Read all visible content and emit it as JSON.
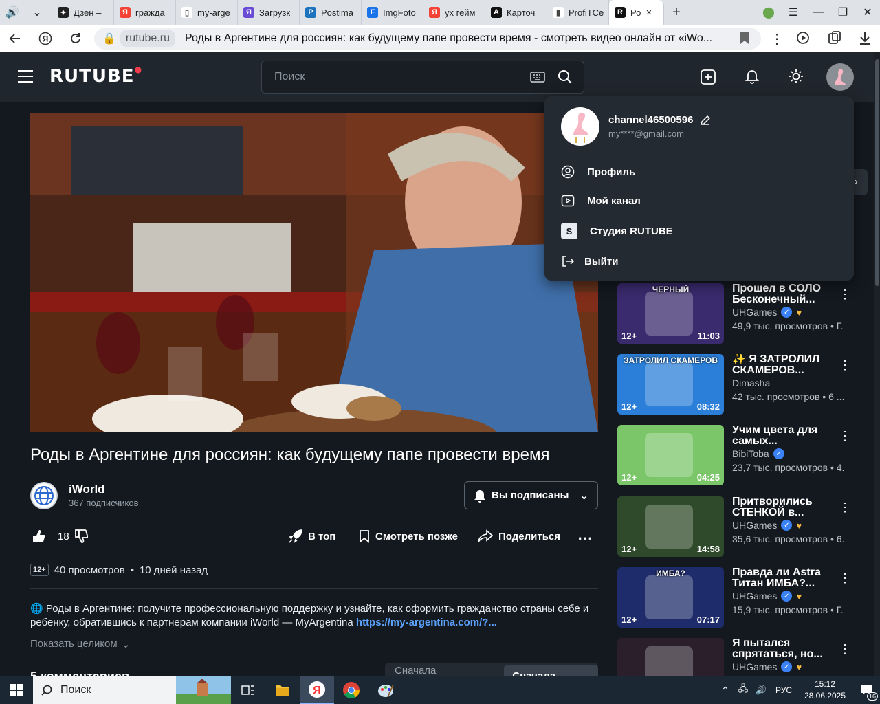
{
  "browser": {
    "tabs": [
      {
        "label": "Дзен –",
        "fav_color": "#222222",
        "fav_glyph": "✦"
      },
      {
        "label": "гражда",
        "fav_color": "#f44336",
        "fav_glyph": "Я"
      },
      {
        "label": "my-arge",
        "fav_color": "#ffffff",
        "fav_glyph": "▯"
      },
      {
        "label": "Загрузк",
        "fav_color": "#6a4bd6",
        "fav_glyph": "Я"
      },
      {
        "label": "Postima",
        "fav_color": "#1e73be",
        "fav_glyph": "P"
      },
      {
        "label": "ImgFoto",
        "fav_color": "#1a73e8",
        "fav_glyph": "F"
      },
      {
        "label": "ух гейм",
        "fav_color": "#f44336",
        "fav_glyph": "Я"
      },
      {
        "label": "Карточ",
        "fav_color": "#111111",
        "fav_glyph": "A"
      },
      {
        "label": "ProfiTCe",
        "fav_color": "#ffffff",
        "fav_glyph": "▮"
      },
      {
        "label": "Ро",
        "fav_color": "#111111",
        "fav_glyph": "R"
      }
    ],
    "url_host": "rutube.ru",
    "url_title": "Роды в Аргентине для россиян: как будущему папе провести время - смотреть видео онлайн от «iWo..."
  },
  "header": {
    "logo": "RUTUBE",
    "search_placeholder": "Поиск"
  },
  "video": {
    "title": "Роды в Аргентине для россиян: как будущему папе провести время",
    "channel_name": "iWorld",
    "subscribers": "367 подписчиков",
    "subscribe_label": "Вы подписаны",
    "likes": "18",
    "top_label": "В топ",
    "watch_later_label": "Смотреть позже",
    "share_label": "Поделиться",
    "age": "12+",
    "views": "40 просмотров",
    "dot": "•",
    "ago": "10 дней назад",
    "description_prefix": "🌐 Роды в Аргентине: получите профессиональную поддержку и узнайте, как оформить гражданство страны себе и ребенку, обратившись к партнерам компании iWorld — MyArgentina ",
    "description_link": "https://my-argentina.com/?...",
    "show_more": "Показать целиком",
    "comments_heading": "5 комментариев",
    "sort_popular": "Сначала популярные",
    "sort_new": "Сначала новые"
  },
  "account_menu": {
    "username": "channel46500596",
    "email": "my****@gmail.com",
    "items": [
      {
        "label": "Профиль",
        "icon": "profile-icon"
      },
      {
        "label": "Мой канал",
        "icon": "play-square-icon"
      },
      {
        "label": "Студия RUTUBE",
        "icon": "studio-icon"
      },
      {
        "label": "Выйти",
        "icon": "logout-icon"
      }
    ]
  },
  "recommendations": [
    {
      "title": "Прошел в СОЛО Бесконечный...",
      "channel": "UHGames",
      "verified": true,
      "heart": true,
      "views": "49,9 тыс. просмотров",
      "ago": "Г.",
      "age": "12+",
      "duration": "11:03",
      "thumb_color": "#3a2a6e",
      "thumb_text": "ЧЕРНЫЙ"
    },
    {
      "title": "✨ Я ЗАТРОЛИЛ СКАМЕРОВ...",
      "channel": "Dimasha",
      "verified": false,
      "heart": false,
      "views": "42 тыс. просмотров",
      "ago": "6 ...",
      "age": "12+",
      "duration": "08:32",
      "thumb_color": "#2b7fd9",
      "thumb_text": "ЗАТРОЛИЛ СКАМЕРОВ"
    },
    {
      "title": "Учим цвета для самых...",
      "channel": "BibiToba",
      "verified": true,
      "heart": false,
      "views": "23,7 тыс. просмотров",
      "ago": "4.",
      "age": "12+",
      "duration": "04:25",
      "thumb_color": "#7cc66a",
      "thumb_text": ""
    },
    {
      "title": "Притворились СТЕНКОЙ в...",
      "channel": "UHGames",
      "verified": true,
      "heart": true,
      "views": "35,6 тыс. просмотров",
      "ago": "6.",
      "age": "12+",
      "duration": "14:58",
      "thumb_color": "#2f4a2a",
      "thumb_text": ""
    },
    {
      "title": "Правда ли Astra Титан ИМБА?...",
      "channel": "UHGames",
      "verified": true,
      "heart": true,
      "views": "15,9 тыс. просмотров",
      "ago": "Г.",
      "age": "12+",
      "duration": "07:17",
      "thumb_color": "#1f2c6b",
      "thumb_text": "ИМБА?"
    },
    {
      "title": "Я пытался спрятаться, но...",
      "channel": "UHGames",
      "verified": true,
      "heart": true,
      "views": "",
      "ago": "",
      "age": "",
      "duration": "",
      "thumb_color": "#2a1f2a",
      "thumb_text": ""
    }
  ],
  "taskbar": {
    "search": "Поиск",
    "lang": "РУС",
    "time": "15:12",
    "date": "28.06.2025",
    "notif_count": "16"
  }
}
